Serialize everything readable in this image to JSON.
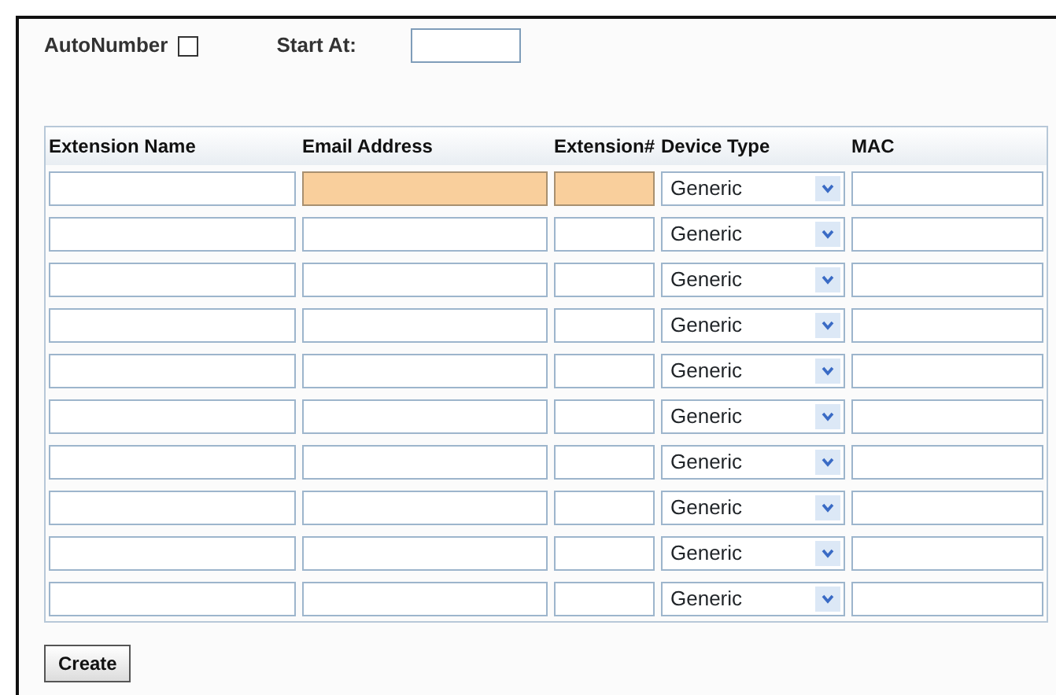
{
  "auto_number": {
    "label": "AutoNumber",
    "checked": false
  },
  "start_at": {
    "label": "Start At:"
  },
  "table": {
    "columns": [
      "Extension Name",
      "Email Address",
      "Extension#",
      "Device Type",
      "MAC"
    ],
    "rows": [
      {
        "device_type": "Generic",
        "email_flagged": true,
        "extension_flagged": true
      },
      {
        "device_type": "Generic",
        "email_flagged": false,
        "extension_flagged": false
      },
      {
        "device_type": "Generic",
        "email_flagged": false,
        "extension_flagged": false
      },
      {
        "device_type": "Generic",
        "email_flagged": false,
        "extension_flagged": false
      },
      {
        "device_type": "Generic",
        "email_flagged": false,
        "extension_flagged": false
      },
      {
        "device_type": "Generic",
        "email_flagged": false,
        "extension_flagged": false
      },
      {
        "device_type": "Generic",
        "email_flagged": false,
        "extension_flagged": false
      },
      {
        "device_type": "Generic",
        "email_flagged": false,
        "extension_flagged": false
      },
      {
        "device_type": "Generic",
        "email_flagged": false,
        "extension_flagged": false
      },
      {
        "device_type": "Generic",
        "email_flagged": false,
        "extension_flagged": false
      }
    ]
  },
  "buttons": [
    "Create"
  ]
}
